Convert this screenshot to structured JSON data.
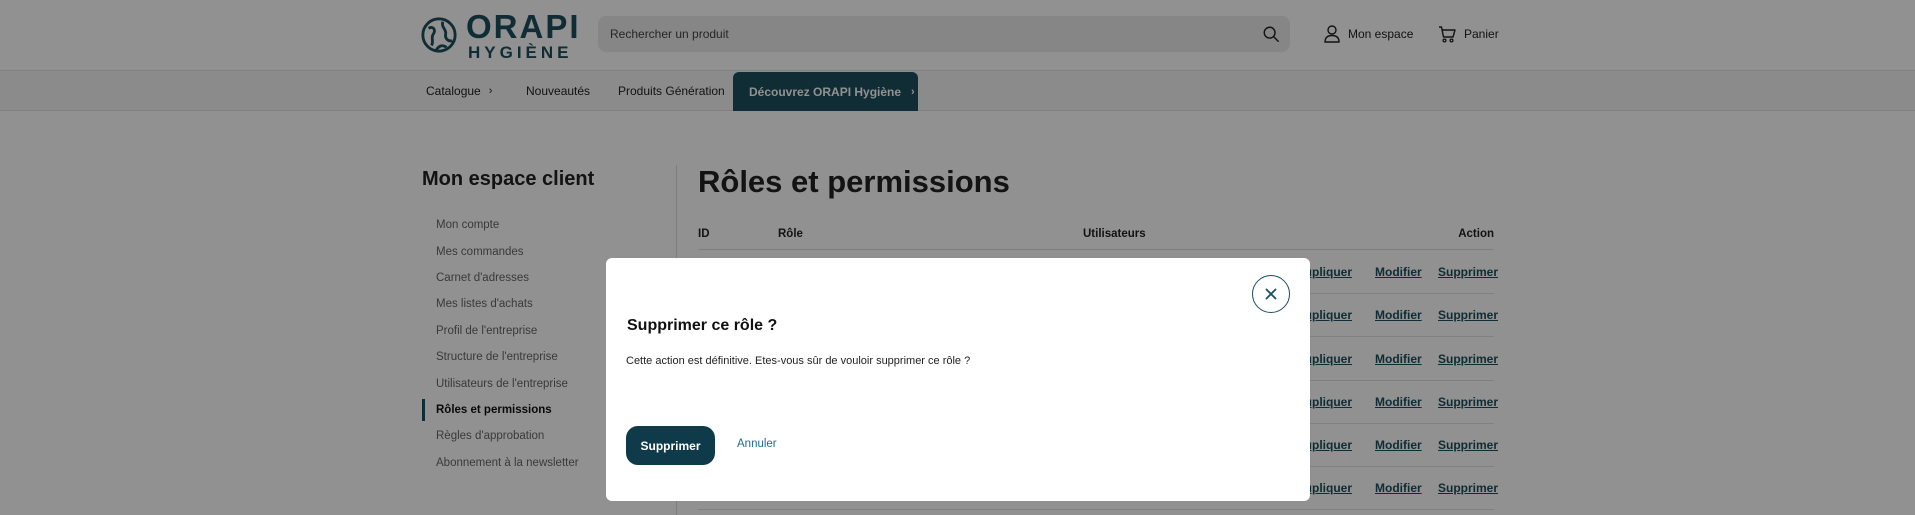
{
  "brand": {
    "name_top": "ORAPI",
    "name_bottom": "HYGIÈNE",
    "color": "#1d4e5c"
  },
  "header": {
    "search": {
      "placeholder": "Rechercher un produit",
      "value": ""
    },
    "account_label": "Mon espace",
    "cart_label": "Panier"
  },
  "nav": {
    "items": [
      {
        "label": "Catalogue",
        "chevron": true
      },
      {
        "label": "Nouveautés"
      },
      {
        "label": "Produits Génération"
      }
    ],
    "cta_label": "Découvrez ORAPI Hygiène"
  },
  "sidebar": {
    "title": "Mon espace client",
    "items": [
      {
        "label": "Mon compte"
      },
      {
        "label": "Mes commandes"
      },
      {
        "label": "Carnet d'adresses"
      },
      {
        "label": "Mes listes d'achats"
      },
      {
        "label": "Profil de l'entreprise"
      },
      {
        "label": "Structure de l'entreprise"
      },
      {
        "label": "Utilisateurs de l'entreprise"
      },
      {
        "label": "Rôles et permissions",
        "active": true
      },
      {
        "label": "Règles d'approbation"
      },
      {
        "label": "Abonnement à la newsletter"
      }
    ]
  },
  "main": {
    "title": "Rôles et permissions",
    "columns": {
      "id": "ID",
      "role": "Rôle",
      "users": "Utilisateurs",
      "action": "Action"
    },
    "row_actions": {
      "duplicate": "Dupliquer",
      "edit": "Modifier",
      "delete": "Supprimer"
    }
  },
  "modal": {
    "title": "Supprimer ce rôle ?",
    "message": "Cette action est définitive. Etes-vous sûr de vouloir supprimer ce rôle ?",
    "confirm_label": "Supprimer",
    "cancel_label": "Annuler"
  },
  "icons": [
    "globe-logo-icon",
    "search-icon",
    "user-icon",
    "cart-icon",
    "chevron-right-icon",
    "close-icon"
  ]
}
